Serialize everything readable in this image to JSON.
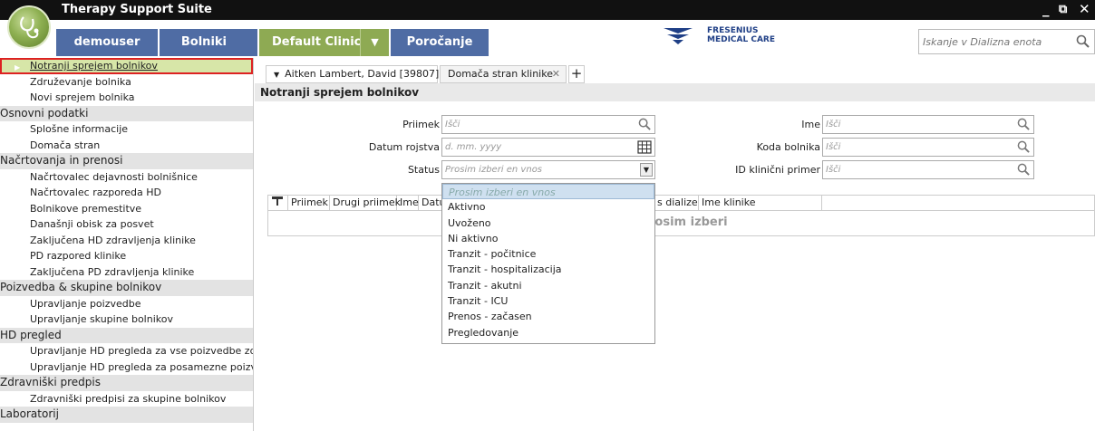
{
  "window": {
    "title": "Therapy Support Suite",
    "controls": "_ ⧉ ✕"
  },
  "nav": {
    "user": "demouser",
    "patients": "Bolniki",
    "clinic": "Default Clinic",
    "reports": "Poročanje",
    "brand_line1": "FRESENIUS",
    "brand_line2": "MEDICAL CARE",
    "search_placeholder": "Iskanje v Dializna enota"
  },
  "sidebar": {
    "items": [
      {
        "label": "Notranji sprejem bolnikov",
        "type": "item",
        "active": true
      },
      {
        "label": "Združevanje bolnika",
        "type": "item"
      },
      {
        "label": "Novi sprejem bolnika",
        "type": "item"
      },
      {
        "label": "Osnovni podatki",
        "type": "head"
      },
      {
        "label": "Splošne informacije",
        "type": "item"
      },
      {
        "label": "Domača stran",
        "type": "item"
      },
      {
        "label": "Načrtovanja in prenosi",
        "type": "head"
      },
      {
        "label": "Načrtovalec dejavnosti bolnišnice",
        "type": "item"
      },
      {
        "label": "Načrtovalec razporeda HD",
        "type": "item"
      },
      {
        "label": "Bolnikove premestitve",
        "type": "item"
      },
      {
        "label": "Današnji obisk za posvet",
        "type": "item"
      },
      {
        "label": "Zaključena HD zdravljenja klinike",
        "type": "item"
      },
      {
        "label": "PD razpored klinike",
        "type": "item"
      },
      {
        "label": "Zaključena PD zdravljenja klinike",
        "type": "item"
      },
      {
        "label": "Poizvedba & skupine bolnikov",
        "type": "head"
      },
      {
        "label": "Upravljanje poizvedbe",
        "type": "item"
      },
      {
        "label": "Upravljanje skupine bolnikov",
        "type": "item"
      },
      {
        "label": "HD pregled",
        "type": "head"
      },
      {
        "label": "Upravljanje HD pregleda za vse poizvedbe zdra...",
        "type": "item"
      },
      {
        "label": "Upravljanje HD pregleda  za posamezne poizve...",
        "type": "item"
      },
      {
        "label": "Zdravniški predpis",
        "type": "head"
      },
      {
        "label": "Zdravniški predpisi za skupine bolnikov",
        "type": "item"
      },
      {
        "label": "Laboratorij",
        "type": "head"
      }
    ]
  },
  "tabs": {
    "patient_tab": "Aitken Lambert, David [39807]",
    "clinic_tab": "Domača stran klinike",
    "add": "+"
  },
  "page": {
    "title": "Notranji sprejem bolnikov"
  },
  "form": {
    "surname_label": "Priimek",
    "surname_placeholder": "Išči",
    "dob_label": "Datum rojstva",
    "dob_placeholder": "d. mm. yyyy",
    "status_label": "Status",
    "status_placeholder": "Prosim izberi en vnos",
    "name_label": "Ime",
    "name_placeholder": "Išči",
    "code_label": "Koda bolnika",
    "code_placeholder": "Išči",
    "clinical_id_label": "ID klinični primer",
    "clinical_id_placeholder": "Išči"
  },
  "grid": {
    "columns": [
      "Priimek",
      "Drugi priimek",
      "Ime",
      "Datum",
      "s dialize",
      "Ime klinike"
    ],
    "empty_text": "rosim izberi"
  },
  "status_options": [
    "Prosim izberi en vnos",
    "Aktivno",
    "Uvoženo",
    "Ni aktivno",
    "Tranzit - počitnice",
    "Tranzit - hospitalizacija",
    "Tranzit - akutni",
    "Tranzit - ICU",
    "Prenos - začasen",
    "Pregledovanje"
  ]
}
